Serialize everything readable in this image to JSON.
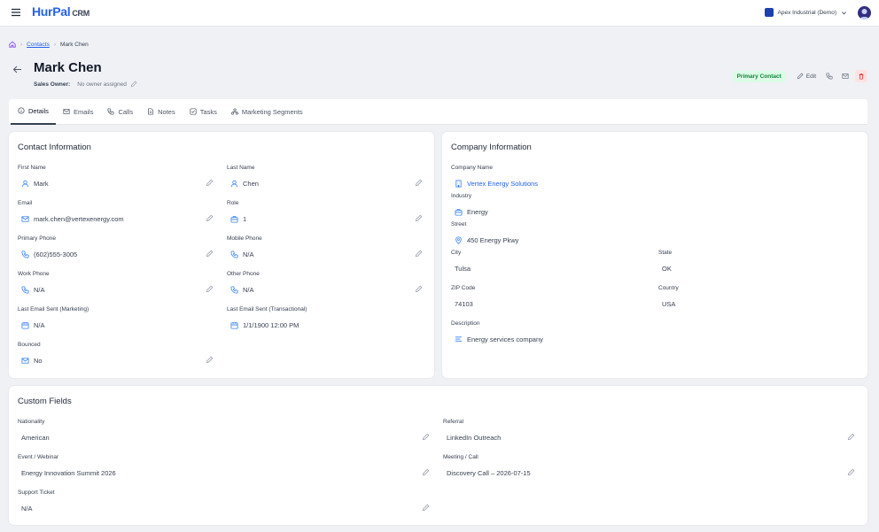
{
  "app": {
    "brand": "HurPal",
    "brand_suffix": "CRM",
    "org_name": "Apex Industrial (Demo)"
  },
  "breadcrumb": {
    "contacts": "Contacts",
    "current": "Mark Chen"
  },
  "header": {
    "name": "Mark Chen",
    "owner_label": "Sales Owner:",
    "owner_value": "No owner assigned",
    "badge": "Primary Contact",
    "edit_label": "Edit"
  },
  "tabs": [
    {
      "label": "Details",
      "icon": "info-icon"
    },
    {
      "label": "Emails",
      "icon": "mail-icon"
    },
    {
      "label": "Calls",
      "icon": "phone-icon"
    },
    {
      "label": "Notes",
      "icon": "note-icon"
    },
    {
      "label": "Tasks",
      "icon": "task-icon"
    },
    {
      "label": "Marketing Segments",
      "icon": "segments-icon"
    }
  ],
  "contact": {
    "title": "Contact Information",
    "fields": [
      {
        "label": "First Name",
        "value": "Mark",
        "icon": "user-icon"
      },
      {
        "label": "Last Name",
        "value": "Chen",
        "icon": "user-icon"
      },
      {
        "label": "Email",
        "value": "mark.chen@vertexenergy.com",
        "icon": "mail-icon"
      },
      {
        "label": "Role",
        "value": "1",
        "icon": "briefcase-icon"
      },
      {
        "label": "Primary Phone",
        "value": "(602)555-3005",
        "icon": "phone-icon"
      },
      {
        "label": "Mobile Phone",
        "value": "N/A",
        "icon": "phone-icon"
      },
      {
        "label": "Work Phone",
        "value": "N/A",
        "icon": "phone-icon"
      },
      {
        "label": "Other Phone",
        "value": "N/A",
        "icon": "phone-icon"
      },
      {
        "label": "Last Email Sent (Marketing)",
        "value": "N/A",
        "icon": "calendar-icon"
      },
      {
        "label": "Last Email Sent (Transactional)",
        "value": "1/1/1900 12:00 PM",
        "icon": "calendar-icon"
      },
      {
        "label": "Bounced",
        "value": "No",
        "icon": "mail-icon"
      }
    ]
  },
  "company": {
    "title": "Company Information",
    "name_label": "Company Name",
    "name": "Vertex Energy Solutions",
    "industry_label": "Industry",
    "industry": "Energy",
    "street_label": "Street",
    "street": "450 Energy Pkwy",
    "city_label": "City",
    "city": "Tulsa",
    "state_label": "State",
    "state": "OK",
    "zip_label": "ZIP Code",
    "zip": "74103",
    "country_label": "Country",
    "country": "USA",
    "description_label": "Description",
    "description": "Energy services company"
  },
  "custom": {
    "title": "Custom Fields",
    "fields": [
      {
        "label": "Nationality",
        "value": "American"
      },
      {
        "label": "Referral",
        "value": "LinkedIn Outreach"
      },
      {
        "label": "Event / Webinar",
        "value": "Energy Innovation Summit 2026"
      },
      {
        "label": "Meeting / Call",
        "value": "Discovery Call – 2026-07-15"
      },
      {
        "label": "Support Ticket",
        "value": "N/A"
      }
    ]
  },
  "colors": {
    "accent": "#2563eb",
    "badge_bg": "#dcfce7",
    "badge_text": "#15803d",
    "page_bg": "#eff1f5"
  }
}
